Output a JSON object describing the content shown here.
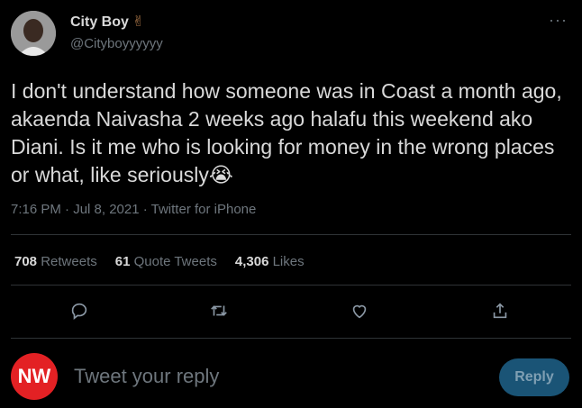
{
  "author": {
    "name": "City Boy",
    "name_emoji": "✌",
    "handle": "@Cityboyyyyyy"
  },
  "tweet": {
    "text": "I don't understand how someone was in Coast a month ago, akaenda Naivasha 2 weeks ago halafu this weekend ako Diani. Is it me who is looking for money in the wrong places or what, like seriously",
    "text_emoji": "😭",
    "timestamp": "7:16 PM · Jul 8, 2021 · Twitter for iPhone"
  },
  "stats": {
    "retweets_count": "708",
    "retweets_label": "Retweets",
    "quote_count": "61",
    "quote_label": "Quote Tweets",
    "likes_count": "4,306",
    "likes_label": "Likes"
  },
  "actions": {
    "reply_icon": "comment-icon",
    "retweet_icon": "retweet-icon",
    "like_icon": "heart-icon",
    "share_icon": "share-icon"
  },
  "reply_box": {
    "avatar_text": "NW",
    "placeholder": "Tweet your reply",
    "button_label": "Reply"
  },
  "more_label": "···",
  "colors": {
    "background": "#000000",
    "text": "#d9d9d9",
    "muted": "#6e767d",
    "accent": "#1a5476",
    "nw_red": "#e32124"
  }
}
